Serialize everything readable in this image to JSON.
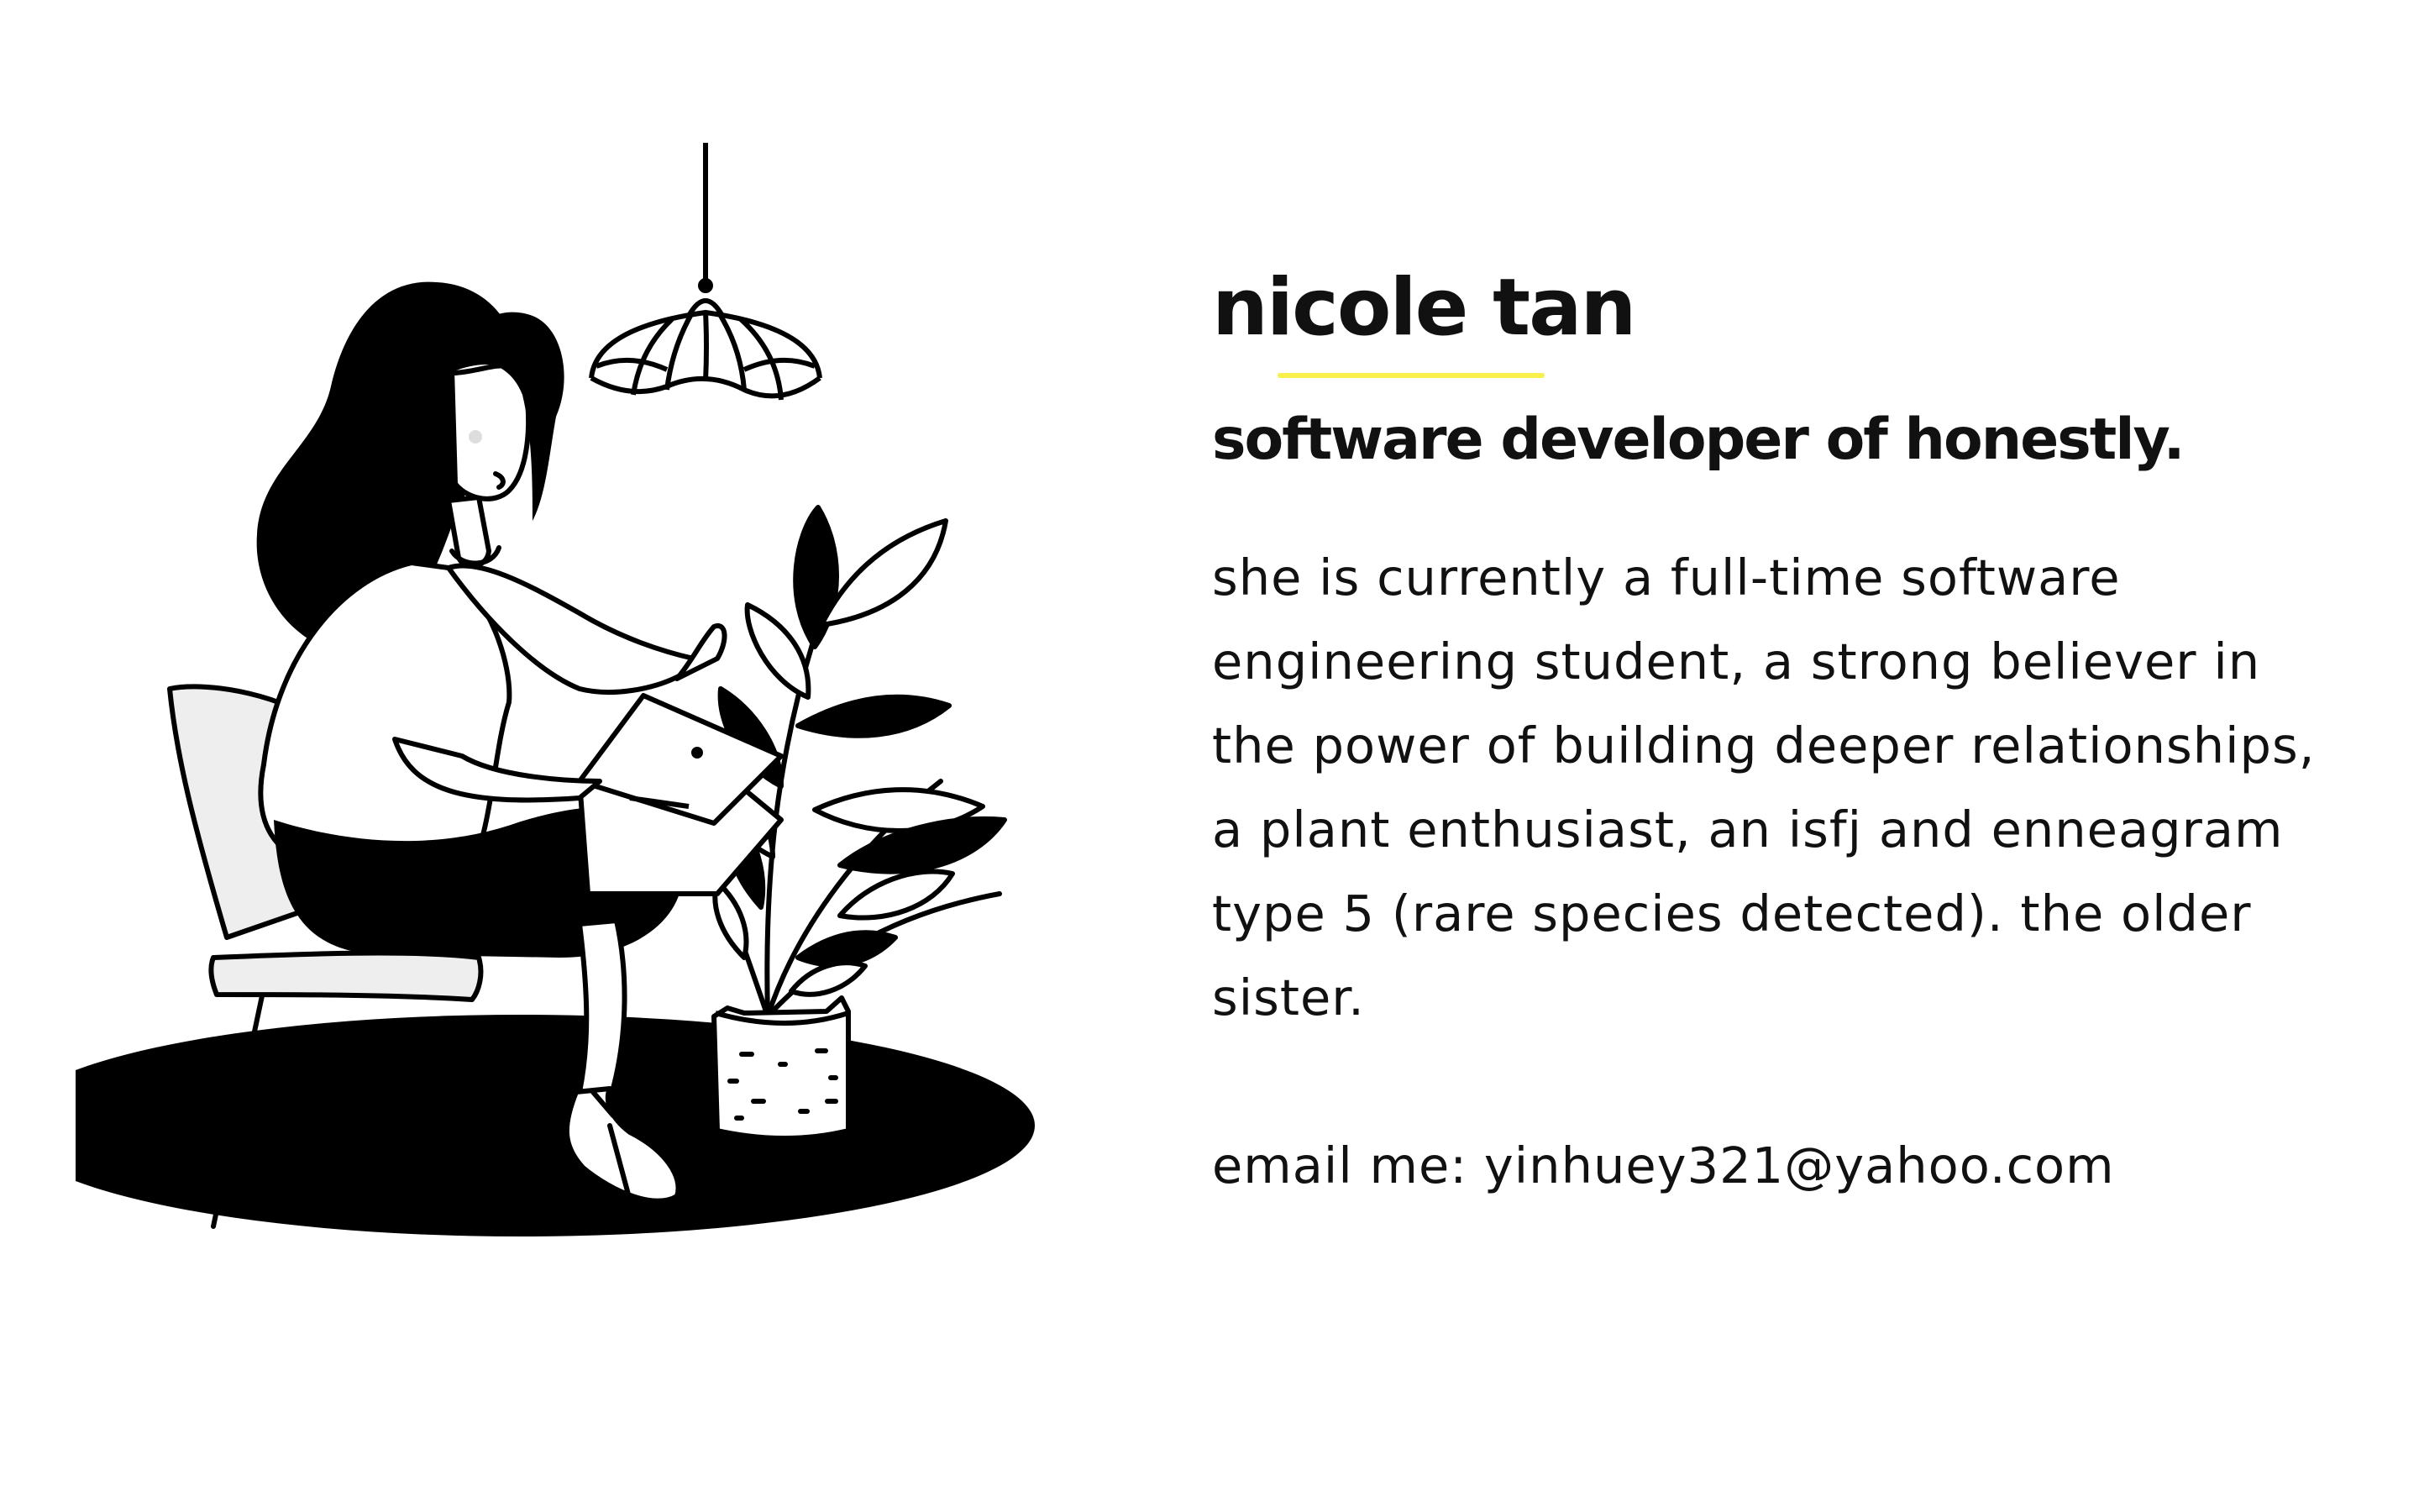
{
  "profile": {
    "name": "nicole tan",
    "subtitle": "software developer of honestly.",
    "bio": "she is currently a full-time software engineering student, a strong believer in the power of building deeper relationships, a plant enthusiast, an isfj and enneagram type 5 (rare species detected). the older sister.",
    "email_prefix": "email me: ",
    "email": "yinhuey321@yahoo.com"
  },
  "colors": {
    "accent": "#f7f04d",
    "text": "#111111",
    "background": "#ffffff"
  },
  "icons": {
    "illustration": "woman-with-laptop-illustration",
    "lamp": "pendant-lamp-icon",
    "plant": "potted-plant-icon",
    "chair": "chair-icon"
  }
}
